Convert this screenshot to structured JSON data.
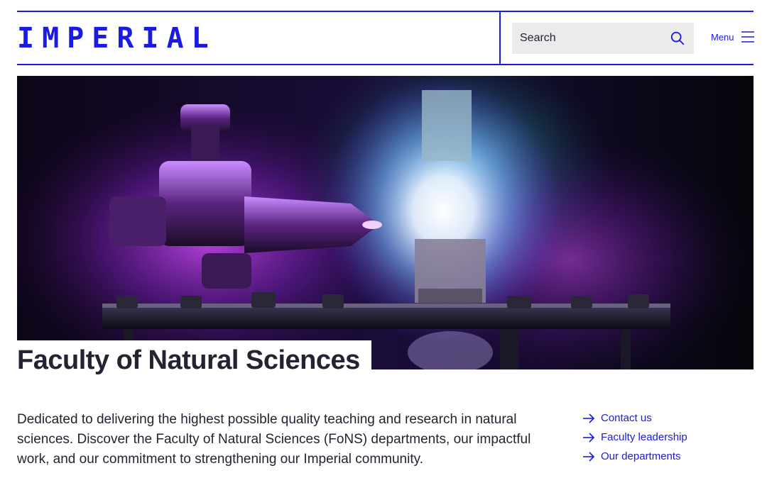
{
  "header": {
    "logo_text": "IMPERIAL",
    "search": {
      "label": "Search"
    },
    "menu_label": "Menu"
  },
  "hero": {
    "title": "Faculty of Natural Sciences"
  },
  "intro": {
    "text": "Dedicated to delivering the highest possible quality teaching and research in natural sciences. Discover the Faculty of Natural Sciences (FoNS) departments, our impactful work, and our commitment to strengthening our Imperial community."
  },
  "quick_links": [
    {
      "label": "Contact us"
    },
    {
      "label": "Faculty leadership"
    },
    {
      "label": "Our departments"
    }
  ],
  "colors": {
    "brand": "#1a1ae0",
    "text": "#232333",
    "search_bg": "#ebebeb"
  },
  "icons": {
    "search": "search-icon",
    "menu": "menu-icon",
    "link_arrow": "arrow-right-icon"
  }
}
